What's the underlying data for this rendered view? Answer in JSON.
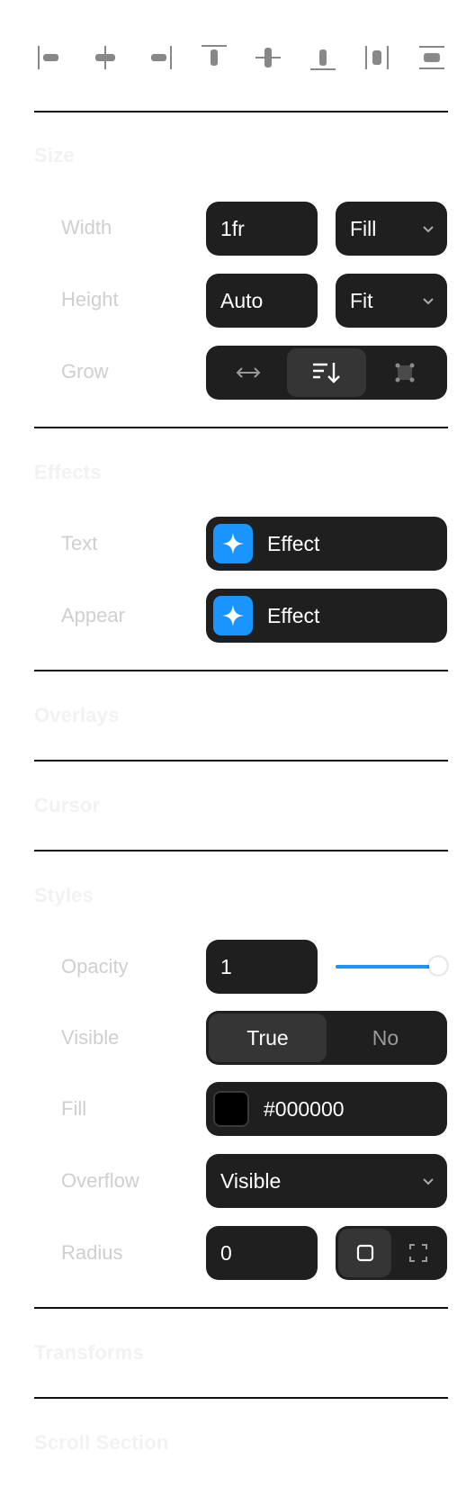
{
  "alignment_icons": [
    "align-left-icon",
    "align-horizontal-center-icon",
    "align-right-icon",
    "align-top-icon",
    "align-vertical-center-icon",
    "align-bottom-icon",
    "distribute-horizontal-icon",
    "distribute-vertical-icon"
  ],
  "sections": {
    "size": "Size",
    "effects": "Effects",
    "overlays": "Overlays",
    "cursor": "Cursor",
    "styles": "Styles",
    "transforms": "Transforms",
    "scroll_section": "Scroll Section"
  },
  "size": {
    "width": {
      "label": "Width",
      "value": "1fr",
      "mode": "Fill"
    },
    "height": {
      "label": "Height",
      "value": "Auto",
      "mode": "Fit"
    },
    "grow": {
      "label": "Grow",
      "options": [
        "horizontal-arrow-icon",
        "text-wrap-icon",
        "frame-icon"
      ],
      "active_index": 1
    }
  },
  "effects": {
    "text": {
      "label": "Text",
      "value": "Effect"
    },
    "appear": {
      "label": "Appear",
      "value": "Effect"
    }
  },
  "styles": {
    "opacity": {
      "label": "Opacity",
      "value": "1",
      "level": 1.0
    },
    "visible": {
      "label": "Visible",
      "options": [
        "True",
        "No"
      ],
      "active_index": 0
    },
    "fill": {
      "label": "Fill",
      "value": "#000000",
      "swatch_color": "#000000"
    },
    "overflow": {
      "label": "Overflow",
      "value": "Visible"
    },
    "radius": {
      "label": "Radius",
      "value": "0",
      "modes": [
        "square-corners-icon",
        "individual-corners-icon"
      ],
      "active_index": 0
    }
  },
  "colors": {
    "accent": "#1a94ff",
    "control_bg": "#1f1f1f",
    "active_bg": "#353535"
  }
}
